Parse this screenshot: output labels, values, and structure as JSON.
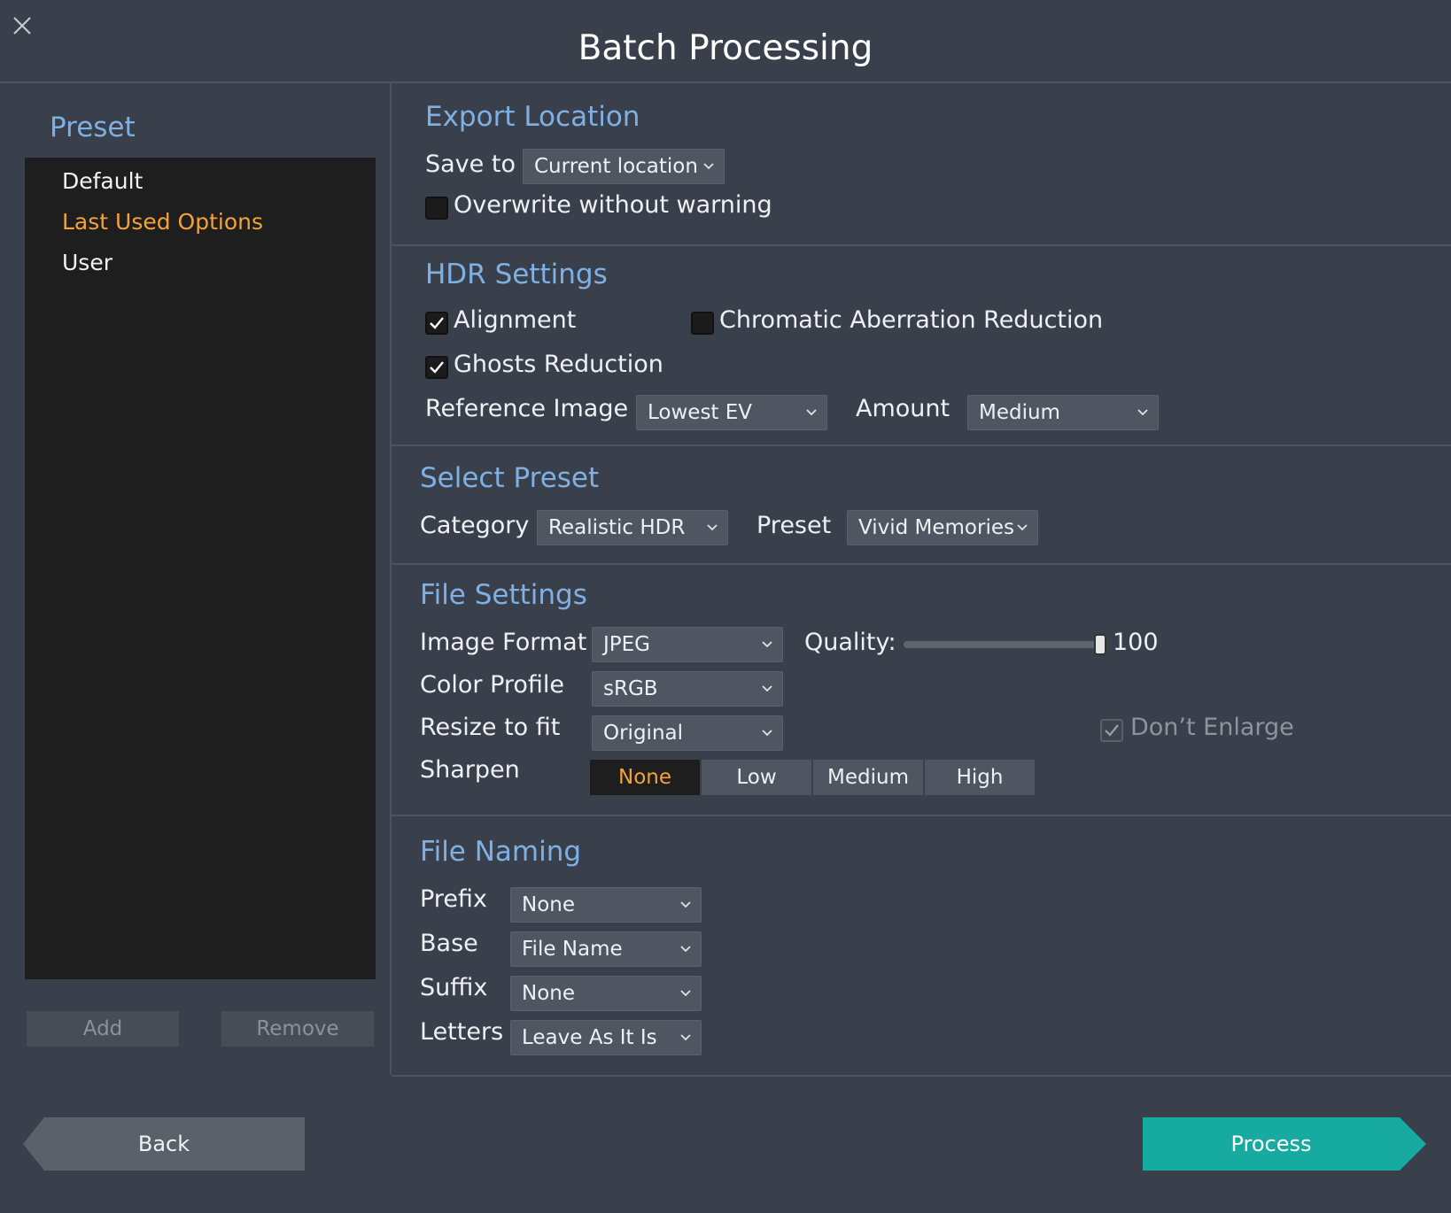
{
  "window": {
    "title": "Batch Processing"
  },
  "left_panel": {
    "heading": "Preset",
    "items": [
      {
        "label": "Default",
        "active": false
      },
      {
        "label": "Last Used Options",
        "active": true
      },
      {
        "label": "User",
        "active": false
      }
    ],
    "add_label": "Add",
    "remove_label": "Remove"
  },
  "export_location": {
    "heading": "Export Location",
    "save_to_label": "Save to",
    "save_to_value": "Current location",
    "overwrite_label": "Overwrite without warning",
    "overwrite_checked": false
  },
  "hdr_settings": {
    "heading": "HDR Settings",
    "alignment_label": "Alignment",
    "alignment_checked": true,
    "chromatic_label": "Chromatic Aberration Reduction",
    "chromatic_checked": false,
    "ghosts_label": "Ghosts Reduction",
    "ghosts_checked": true,
    "reference_label": "Reference Image",
    "reference_value": "Lowest EV",
    "amount_label": "Amount",
    "amount_value": "Medium"
  },
  "select_preset": {
    "heading": "Select Preset",
    "category_label": "Category",
    "category_value": "Realistic HDR",
    "preset_label": "Preset",
    "preset_value": "Vivid Memories"
  },
  "file_settings": {
    "heading": "File Settings",
    "format_label": "Image Format",
    "format_value": "JPEG",
    "quality_label": "Quality:",
    "quality_value": "100",
    "quality_fraction": 1.0,
    "color_profile_label": "Color Profile",
    "color_profile_value": "sRGB",
    "resize_label": "Resize to fit",
    "resize_value": "Original",
    "dont_enlarge_label": "Don’t Enlarge",
    "dont_enlarge_checked": true,
    "sharpen_label": "Sharpen",
    "sharpen_options": [
      "None",
      "Low",
      "Medium",
      "High"
    ],
    "sharpen_selected": "None"
  },
  "file_naming": {
    "heading": "File Naming",
    "prefix_label": "Prefix",
    "prefix_value": "None",
    "base_label": "Base",
    "base_value": "File Name",
    "suffix_label": "Suffix",
    "suffix_value": "None",
    "letters_label": "Letters",
    "letters_value": "Leave As It Is"
  },
  "footer": {
    "back_label": "Back",
    "process_label": "Process"
  },
  "colors": {
    "background": "#3a404b",
    "section_heading": "#7fb0e3",
    "accent_orange": "#f3a23a",
    "process_teal": "#17aaa0"
  }
}
